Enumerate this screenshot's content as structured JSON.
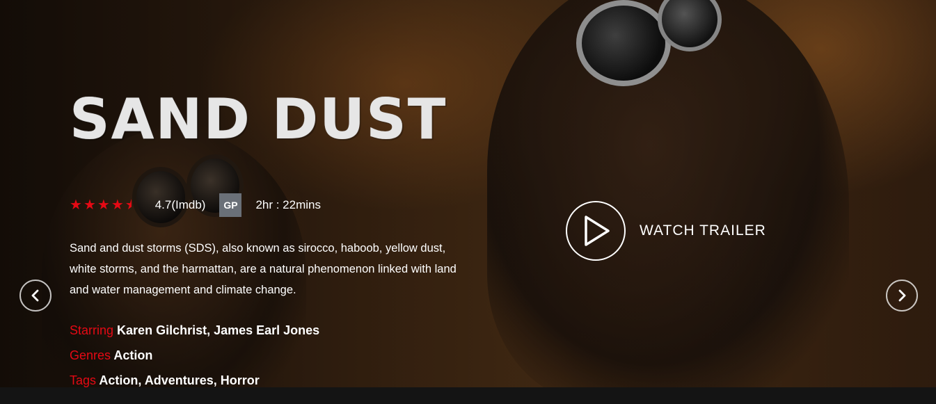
{
  "hero": {
    "title": "SAND DUST",
    "rating": {
      "stars": 4.5,
      "max_stars": 5,
      "text": "4.7(Imdb)",
      "star_color": "#e50914"
    },
    "certificate": "GP",
    "duration": "2hr : 22mins",
    "description": "Sand and dust storms (SDS), also known as sirocco, haboob, yellow dust, white storms, and the harmattan, are a natural phenomenon linked with land and water management and climate change.",
    "starring": {
      "label": "Starring",
      "value": "Karen Gilchrist, James Earl Jones"
    },
    "genres": {
      "label": "Genres",
      "value": "Action"
    },
    "tags": {
      "label": "Tags",
      "value": "Action, Adventures, Horror"
    },
    "trailer": {
      "label": "WATCH TRAILER",
      "icon": "play-icon"
    },
    "navigation": {
      "prev_icon": "chevron-left-icon",
      "next_icon": "chevron-right-icon"
    }
  },
  "theme": {
    "accent": "#e50914",
    "badge_bg": "#6a7078",
    "text": "#ffffff",
    "bottom_bar": "#141414"
  }
}
